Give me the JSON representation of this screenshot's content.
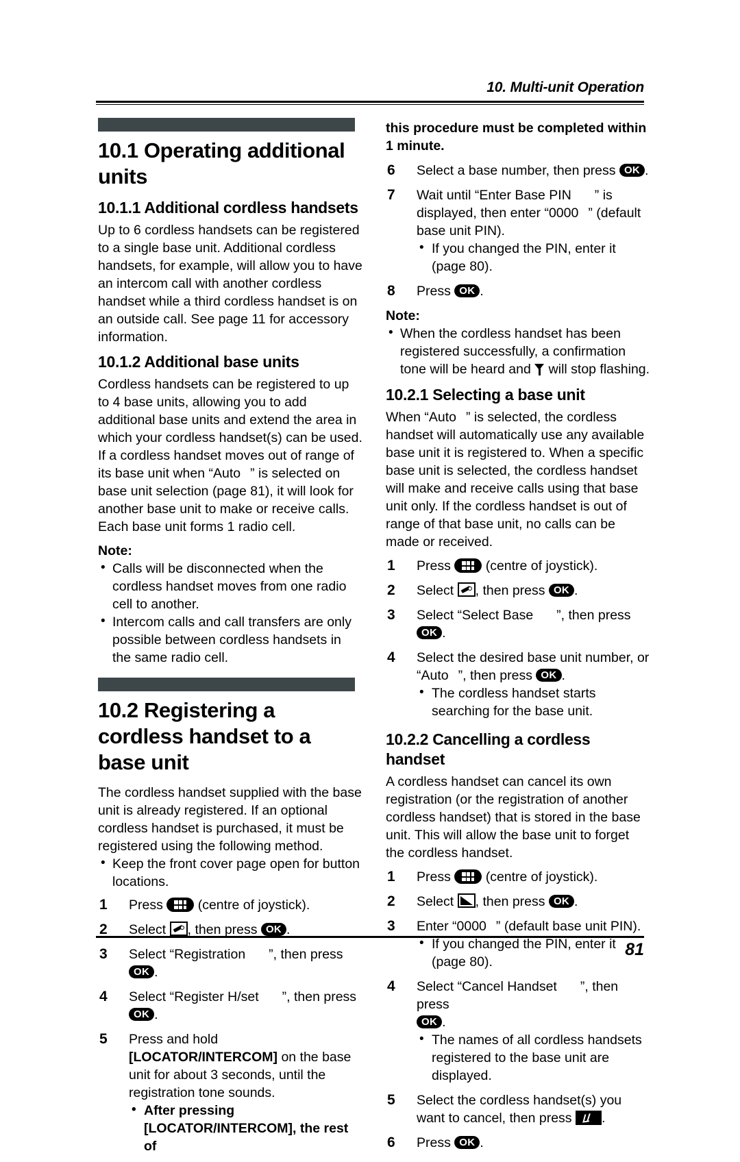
{
  "header": {
    "chapter": "10. Multi-unit Operation"
  },
  "footer": {
    "page_number": "81"
  },
  "left_column": {
    "section_10_1": {
      "heading": "10.1 Operating additional units",
      "sub_10_1_1": {
        "heading": "10.1.1 Additional cordless handsets",
        "body": "Up to 6 cordless handsets can be registered to a single base unit. Additional cordless handsets, for example, will allow you to have an intercom call with another cordless handset while a third cordless handset is on an outside call. See page 11 for accessory information."
      },
      "sub_10_1_2": {
        "heading": "10.1.2 Additional base units",
        "body_part1": "Cordless handsets can be registered to up to 4 base units, allowing you to add additional base units and extend the area in which your cordless handset(s) can be used. If a cordless handset moves out of range of its base unit when “Auto",
        "body_part2": "” is selected on base unit selection (page 81), it will look for another base unit to make or receive calls. Each base unit forms 1 radio cell.",
        "note_label": "Note:",
        "notes": [
          "Calls will be disconnected when the cordless handset moves from one radio cell to another.",
          "Intercom calls and call transfers are only possible between cordless handsets in the same radio cell."
        ]
      }
    },
    "section_10_2": {
      "heading": "10.2 Registering a cordless handset to a base unit",
      "body": "The cordless handset supplied with the base unit is already registered. If an optional cordless handset is purchased, it must be registered using the following method.",
      "intro_bullets": [
        "Keep the front cover page open for button locations."
      ],
      "steps": [
        {
          "num": "1",
          "pre": "Press",
          "key": "joystick-key",
          "post": "(centre of joystick)."
        },
        {
          "num": "2",
          "pre": "Select",
          "key": "pencil-box-icon",
          "mid": ", then press",
          "key2": "ok-key",
          "post": "."
        },
        {
          "num": "3",
          "pre": "Select “Registration",
          "quote_close": "”, then press",
          "key2": "ok-key",
          "post": "."
        },
        {
          "num": "4",
          "pre": "Select “Register H/set",
          "quote_close": "”, then press",
          "key2": "ok-key",
          "post": "."
        },
        {
          "num": "5",
          "text_before": "Press and hold",
          "bracket_key": "[LOCATOR/INTERCOM]",
          "text_after": "on the base unit for about 3 seconds, until the registration tone sounds.",
          "sub_bullet_before": "After pressing",
          "sub_bullet_key": "[LOCATOR/INTERCOM]",
          "sub_bullet_after": ", the rest of"
        }
      ]
    }
  },
  "right_column": {
    "continued_bullet": "this procedure must be completed within 1 minute.",
    "steps_continued": [
      {
        "num": "6",
        "pre": "Select a base number, then press",
        "key": "ok-key",
        "post": "."
      },
      {
        "num": "7",
        "pre": "Wait until “Enter Base PIN",
        "quote_close": "” is displayed, then enter “0000",
        "post": "” (default base unit PIN).",
        "bullets": [
          "If you changed the PIN, enter it (page 80)."
        ]
      },
      {
        "num": "8",
        "pre": "Press",
        "key": "ok-key",
        "post": "."
      }
    ],
    "note_label": "Note:",
    "notes": [
      {
        "part1": "When the cordless handset has been registered successfully, a confirmation tone will be heard and",
        "icon": "antenna-icon",
        "part2": "will stop flashing."
      }
    ],
    "sub_10_2_1": {
      "heading": "10.2.1 Selecting a base unit",
      "body_part1": "When “Auto",
      "body_part2": "” is selected, the cordless handset will automatically use any available base unit it is registered to. When a specific base unit is selected, the cordless handset will make and receive calls using that base unit only. If the cordless handset is out of range of that base unit, no calls can be made or received.",
      "steps": [
        {
          "num": "1",
          "pre": "Press",
          "key": "joystick-key",
          "post": "(centre of joystick)."
        },
        {
          "num": "2",
          "pre": "Select",
          "key": "pencil-box-icon",
          "mid": ", then press",
          "key2": "ok-key",
          "post": "."
        },
        {
          "num": "3",
          "pre": "Select “Select Base",
          "quote_close": "”, then press",
          "key2": "ok-key",
          "post": "."
        },
        {
          "num": "4",
          "pre": "Select the desired base unit number, or “Auto",
          "quote_close": "”, then press",
          "key2": "ok-key",
          "post": ".",
          "bullets": [
            "The cordless handset starts searching for the base unit."
          ]
        }
      ]
    },
    "sub_10_2_2": {
      "heading": "10.2.2 Cancelling a cordless handset",
      "body": "A cordless handset can cancel its own registration (or the registration of another cordless handset) that is stored in the base unit. This will allow the base unit to forget the cordless handset.",
      "steps": [
        {
          "num": "1",
          "pre": "Press",
          "key": "joystick-key",
          "post": "(centre of joystick)."
        },
        {
          "num": "2",
          "pre": "Select",
          "key": "wedge-box-icon",
          "mid": ", then press",
          "key2": "ok-key",
          "post": "."
        },
        {
          "num": "3",
          "pre": "Enter “0000",
          "post": "” (default base unit PIN).",
          "bullets": [
            "If you changed the PIN, enter it (page 80)."
          ]
        },
        {
          "num": "4",
          "pre": "Select “Cancel Handset",
          "quote_close": "”, then press",
          "key2": "ok-key",
          "post": ".",
          "bullets": [
            "The names of all cordless handsets registered to the base unit are displayed."
          ]
        },
        {
          "num": "5",
          "pre": "Select the cordless handset(s) you want to cancel, then press",
          "key": "check-key",
          "post": "."
        },
        {
          "num": "6",
          "pre": "Press",
          "key": "ok-key",
          "post": "."
        }
      ]
    }
  },
  "colors": {
    "banner": "#3d4749",
    "text": "#000000",
    "page_background": "#ffffff"
  }
}
